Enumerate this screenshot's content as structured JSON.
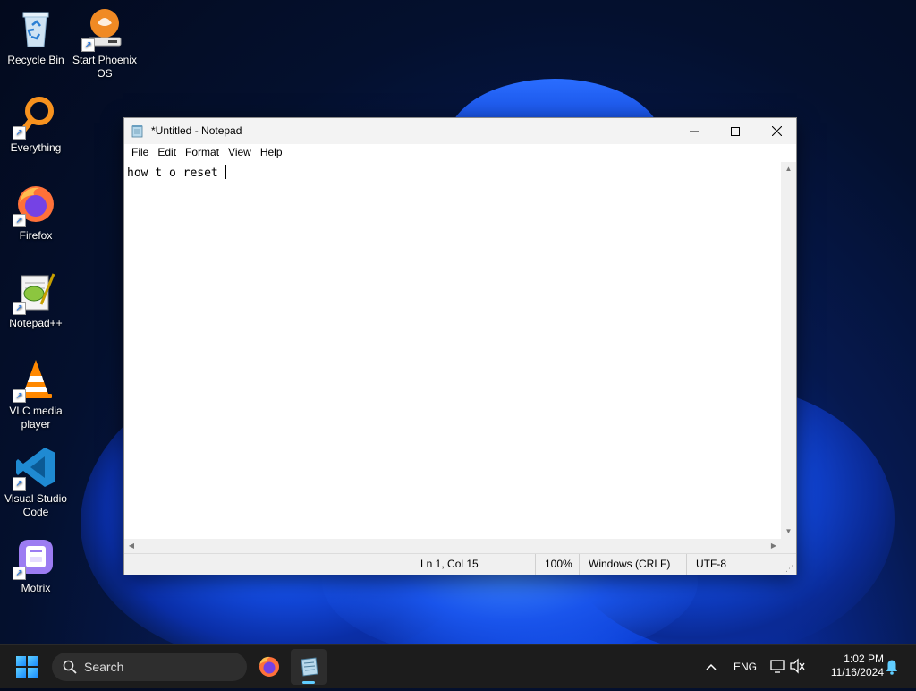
{
  "desktop": {
    "icons": [
      {
        "label": "Recycle Bin",
        "icon": "recycle-bin-icon",
        "shortcut": false
      },
      {
        "label": "Start Phoenix OS",
        "icon": "phoenix-os-icon",
        "shortcut": true
      },
      {
        "label": "Everything",
        "icon": "everything-search-icon",
        "shortcut": true
      },
      {
        "label": "Firefox",
        "icon": "firefox-icon",
        "shortcut": true
      },
      {
        "label": "Notepad++",
        "icon": "notepad-plus-plus-icon",
        "shortcut": true
      },
      {
        "label": "VLC media player",
        "icon": "vlc-icon",
        "shortcut": true
      },
      {
        "label": "Visual Studio Code",
        "icon": "vscode-icon",
        "shortcut": true
      },
      {
        "label": "Motrix",
        "icon": "motrix-icon",
        "shortcut": true
      }
    ]
  },
  "notepad": {
    "title": "*Untitled - Notepad",
    "menu": [
      "File",
      "Edit",
      "Format",
      "View",
      "Help"
    ],
    "content": "how t o reset ",
    "status": {
      "position": "Ln 1, Col 15",
      "zoom": "100%",
      "line_ending": "Windows (CRLF)",
      "encoding": "UTF-8"
    }
  },
  "taskbar": {
    "search_label": "Search",
    "tray_language": "ENG",
    "clock_time": "1:02 PM",
    "clock_date": "11/16/2024"
  },
  "colors": {
    "accent": "#60cdff",
    "taskbar_bg": "#1c1c1c",
    "window_chrome": "#f3f3f3"
  }
}
